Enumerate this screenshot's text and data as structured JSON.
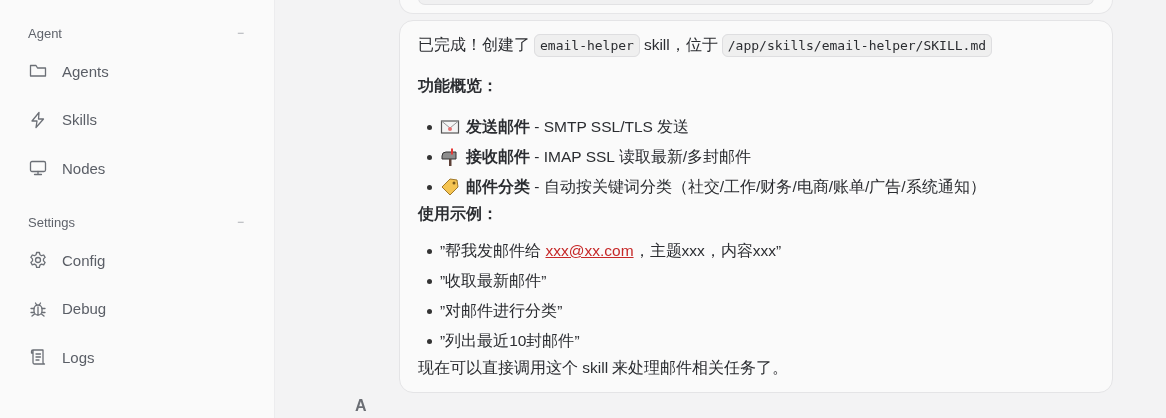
{
  "sidebar": {
    "sections": [
      {
        "title": "Agent",
        "toggle": "−",
        "items": [
          {
            "kind": "folder",
            "label": "Agents"
          },
          {
            "kind": "bolt",
            "label": "Skills"
          },
          {
            "kind": "monitor",
            "label": "Nodes"
          }
        ]
      },
      {
        "title": "Settings",
        "toggle": "−",
        "items": [
          {
            "kind": "gear",
            "label": "Config"
          },
          {
            "kind": "bug",
            "label": "Debug"
          },
          {
            "kind": "scroll",
            "label": "Logs"
          }
        ]
      }
    ]
  },
  "message": {
    "intro": [
      {
        "kind": "text",
        "text": "已完成！创建了"
      },
      {
        "kind": "code",
        "text": "email-helper"
      },
      {
        "kind": "text",
        "text": "skill，位于"
      },
      {
        "kind": "code",
        "text": "/app/skills/email-helper/SKILL.md"
      }
    ],
    "features_heading": "功能概览：",
    "features": [
      {
        "kind": "envelope",
        "name": "发送邮件",
        "desc": " - SMTP SSL/TLS 发送"
      },
      {
        "kind": "mailbox",
        "name": "接收邮件",
        "desc": " - IMAP SSL 读取最新/多封邮件"
      },
      {
        "kind": "tag",
        "name": "邮件分类",
        "desc": " - 自动按关键词分类（社交/工作/财务/电商/账单/广告/系统通知）"
      }
    ],
    "examples_heading": "使用示例：",
    "examples": [
      [
        {
          "kind": "text",
          "text": "”帮我发邮件给 "
        },
        {
          "kind": "link",
          "text": "xxx@xx.com"
        },
        {
          "kind": "text",
          "text": "，主题xxx，内容xxx”"
        }
      ],
      [
        {
          "kind": "text",
          "text": "”收取最新邮件”"
        }
      ],
      [
        {
          "kind": "text",
          "text": "”对邮件进行分类”"
        }
      ],
      [
        {
          "kind": "text",
          "text": "”列出最近10封邮件”"
        }
      ]
    ],
    "closing": "现在可以直接调用这个 skill 来处理邮件相关任务了。"
  },
  "avatar": "A"
}
